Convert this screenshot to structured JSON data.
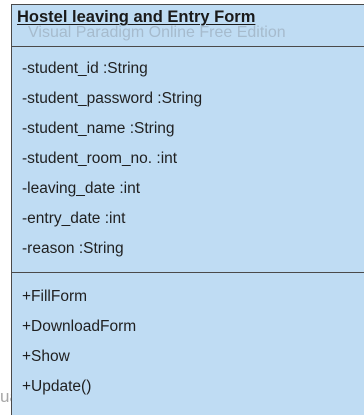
{
  "class": {
    "name": "Hostel leaving and Entry Form",
    "attributes": [
      "-student_id :String",
      "-student_password :String",
      "-student_name :String",
      "-student_room_no. :int",
      "-leaving_date :int",
      "-entry_date :int",
      "-reason :String"
    ],
    "operations": [
      "+FillForm",
      "+DownloadForm",
      "+Show",
      "+Update()"
    ]
  },
  "watermark": {
    "top": "Visual Paradigm Online Free Edition",
    "bottom": "ual Paradigm Online Free Edition"
  },
  "colors": {
    "fill": "#bfdcf3",
    "border": "#4a4a4a"
  }
}
